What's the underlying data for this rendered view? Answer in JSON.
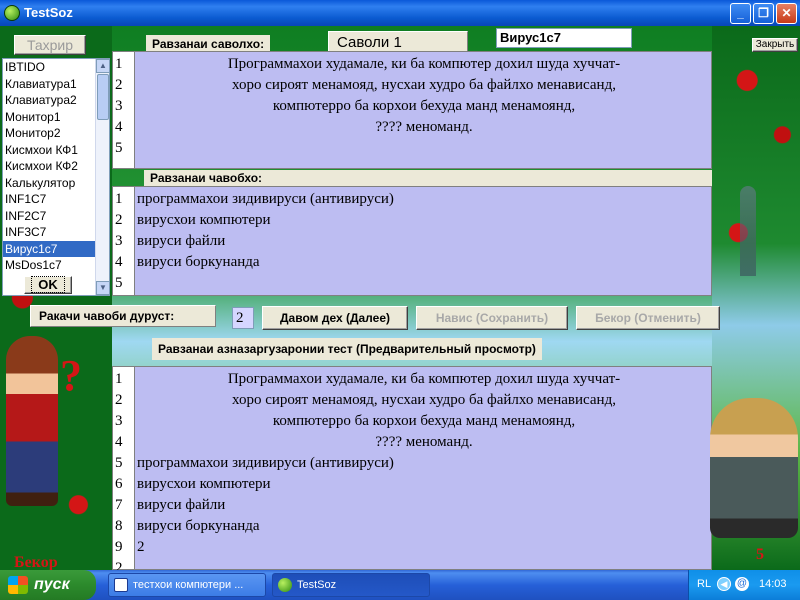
{
  "window": {
    "title": "TestSoz",
    "close_button": "Закрыть"
  },
  "toolbar": {
    "edit_label": "Тахрир",
    "question_section_label": "Равзанаи саволхо:",
    "question_number": "Саволи  1",
    "test_name": "Вирус1с7"
  },
  "list": {
    "items": [
      "IBTIDO",
      "Клавиатура1",
      "Клавиатура2",
      "Монитор1",
      "Монитор2",
      "Кисмхои КФ1",
      "Кисмхои КФ2",
      "Калькулятор",
      "INF1C7",
      "INF2C7",
      "INF3C7",
      "Вирус1с7",
      "MsDos1c7"
    ],
    "selected_index": 11,
    "ok_label": "OK"
  },
  "question": {
    "line_numbers": [
      "1",
      "2",
      "3",
      "4",
      "5"
    ],
    "lines": [
      "Программахои худамале, ки ба компютер дохил шуда хуччат-",
      "хоро сироят менамояд, нусхаи худро ба файлхо менависанд,",
      "компютерро ба корхои бехуда манд менамоянд,",
      "????    меноманд.",
      ""
    ]
  },
  "answers": {
    "section_label": "Равзанаи чавобхо:",
    "line_numbers": [
      "1",
      "2",
      "3",
      "4",
      "5"
    ],
    "lines": [
      "программахои зидивируси (антивируси)",
      "вирусхои компютери",
      "вируси файли",
      "вируси боркунанда",
      ""
    ]
  },
  "controls": {
    "correct_answer_label": "Ракачи чавоби дуруст:",
    "correct_answer_value": "2",
    "next_button": "Давом дех (Далее)",
    "save_button": "Навис (Сохранить)",
    "cancel_button": "Бекор (Отменить)"
  },
  "preview": {
    "section_label": "Равзанаи азназаргузаронии тест  (Предварительный просмотр)",
    "line_numbers": [
      "1",
      "2",
      "3",
      "4",
      "5",
      "6",
      "7",
      "8",
      "9",
      "2"
    ],
    "lines": [
      "Программахои худамале, ки ба компютер дохил шуда хуччат-",
      "хоро сироят менамояд, нусхаи худро ба файлхо менависанд,",
      "компютерро ба корхои бехуда манд менамоянд,",
      "????    меноманд.",
      "программахои зидивируси (антивируси)",
      "вирусхои компютери",
      "вируси файли",
      "вируси боркунанда",
      "2",
      ""
    ]
  },
  "bottom": {
    "left_text": "Бекор",
    "right_text": "5"
  },
  "taskbar": {
    "start_label": "пуск",
    "tasks": [
      {
        "label": "тестхои компютери ..."
      },
      {
        "label": "TestSoz"
      }
    ],
    "language": "RL",
    "clock": "14:03"
  }
}
